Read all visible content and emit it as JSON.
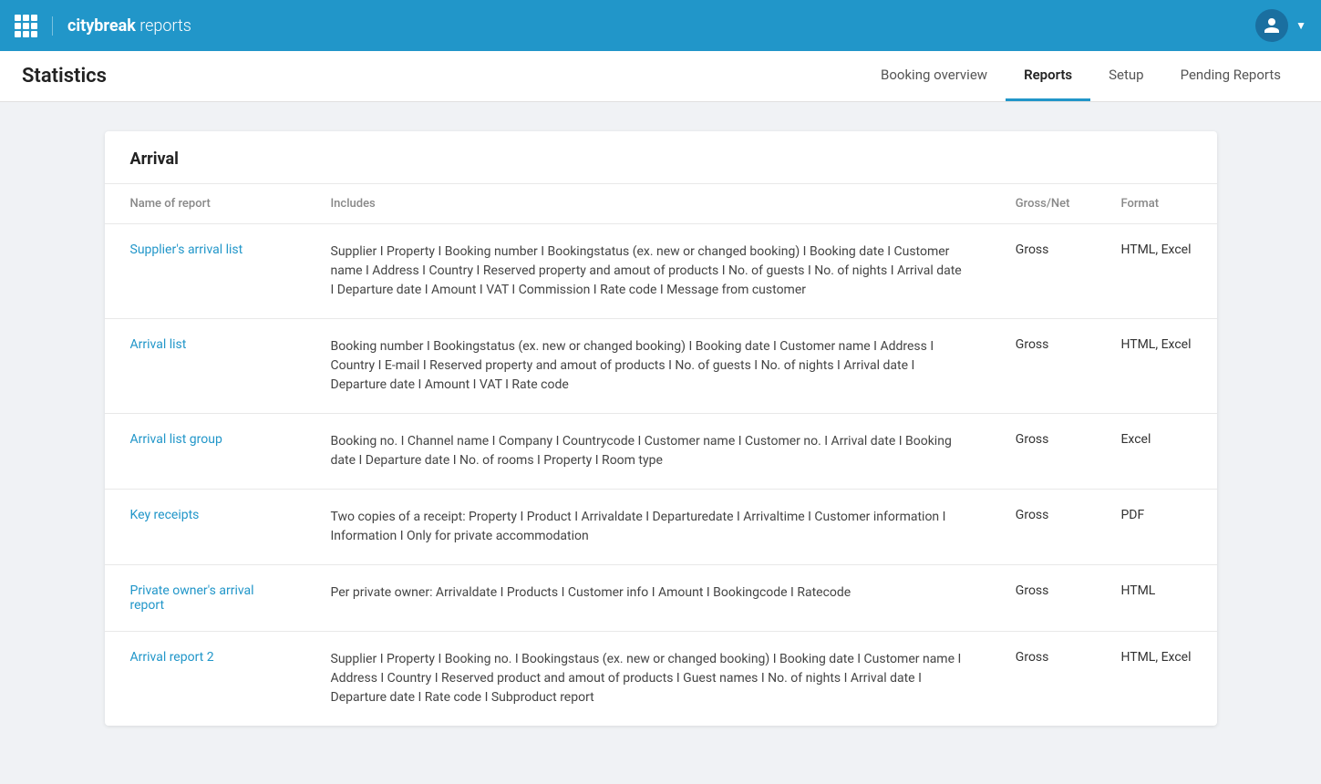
{
  "topbar": {
    "brand_bold": "citybreak",
    "brand_light": " reports",
    "grid_icon_label": "app-grid"
  },
  "secondnav": {
    "page_title": "Statistics",
    "nav_items": [
      {
        "id": "booking-overview",
        "label": "Booking overview",
        "active": false
      },
      {
        "id": "reports",
        "label": "Reports",
        "active": true
      },
      {
        "id": "setup",
        "label": "Setup",
        "active": false
      },
      {
        "id": "pending-reports",
        "label": "Pending Reports",
        "active": false
      }
    ]
  },
  "card": {
    "section_title": "Arrival",
    "columns": {
      "name": "Name of report",
      "includes": "Includes",
      "gross_net": "Gross/Net",
      "format": "Format"
    },
    "rows": [
      {
        "id": "suppliers-arrival-list",
        "name": "Supplier's arrival list",
        "includes": "Supplier I Property I Booking number I Bookingstatus (ex. new or changed booking) I Booking date I Customer name I Address I Country I Reserved property and amout of products I No. of guests I No. of nights I Arrival date I Departure date I Amount I VAT I Commission I Rate code I Message from customer",
        "gross_net": "Gross",
        "format": "HTML, Excel"
      },
      {
        "id": "arrival-list",
        "name": "Arrival list",
        "includes": "Booking number I Bookingstatus (ex. new or changed booking) I Booking date I Customer name I Address I Country I E-mail I Reserved property and amout of products I No. of guests I No. of nights I Arrival date I Departure date I Amount I VAT I Rate code",
        "gross_net": "Gross",
        "format": "HTML, Excel"
      },
      {
        "id": "arrival-list-group",
        "name": "Arrival list group",
        "includes": "Booking no. I Channel name I Company I Countrycode I Customer name I Customer no. I Arrival date I Booking date I Departure date I No. of rooms I Property I Room type",
        "gross_net": "Gross",
        "format": "Excel"
      },
      {
        "id": "key-receipts",
        "name": "Key receipts",
        "includes": "Two copies of a receipt: Property I Product I Arrivaldate I Departuredate I Arrivaltime I Customer information I Information I Only for private accommodation",
        "gross_net": "Gross",
        "format": "PDF"
      },
      {
        "id": "private-owners-arrival-report",
        "name": "Private owner's arrival report",
        "includes": "Per private owner: Arrivaldate I Products I Customer info I Amount I Bookingcode I Ratecode",
        "gross_net": "Gross",
        "format": "HTML"
      },
      {
        "id": "arrival-report-2",
        "name": "Arrival report 2",
        "includes": "Supplier I Property I Booking no. I Bookingstaus (ex. new or changed booking) I Booking date I Customer name I Address I Country I Reserved product and amout of products I Guest names I No. of nights I Arrival date I Departure date I Rate code I Subproduct report",
        "gross_net": "Gross",
        "format": "HTML, Excel"
      }
    ]
  }
}
